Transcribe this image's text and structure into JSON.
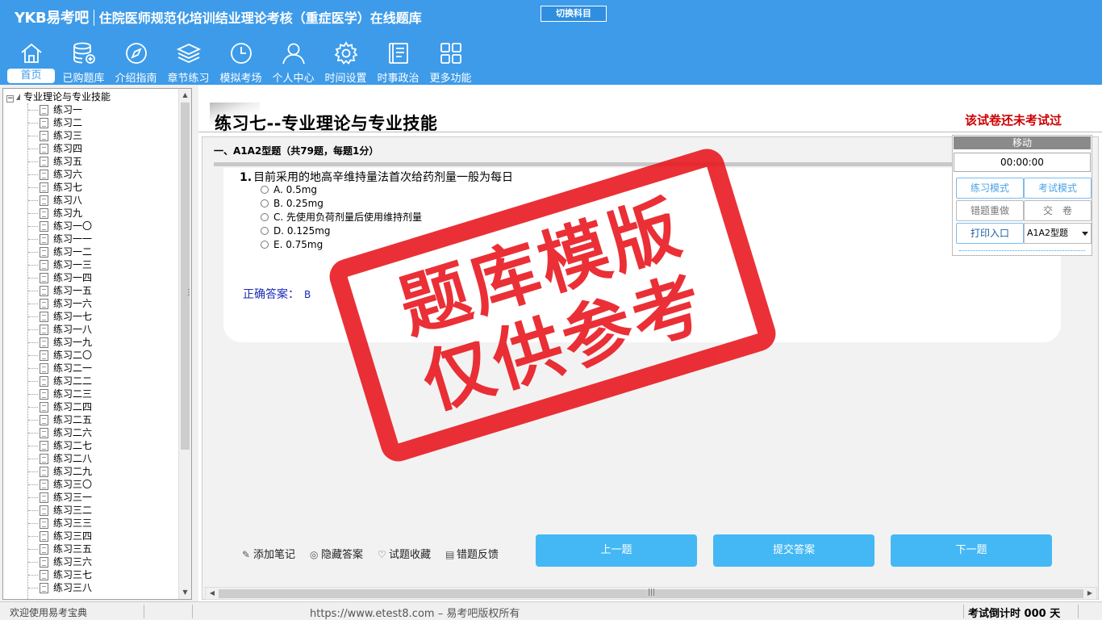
{
  "header": {
    "logo": "YKB易考吧",
    "title": "住院医师规范化培训结业理论考核（重症医学）在线题库",
    "switch_label": "切换科目"
  },
  "nav": [
    {
      "label": "首页",
      "icon": "home-icon"
    },
    {
      "label": "已购题库",
      "icon": "database-icon"
    },
    {
      "label": "介绍指南",
      "icon": "compass-icon"
    },
    {
      "label": "章节练习",
      "icon": "layers-icon"
    },
    {
      "label": "模拟考场",
      "icon": "clock-icon"
    },
    {
      "label": "个人中心",
      "icon": "user-icon"
    },
    {
      "label": "时间设置",
      "icon": "gear-icon"
    },
    {
      "label": "时事政治",
      "icon": "news-icon"
    },
    {
      "label": "更多功能",
      "icon": "grid-icon"
    }
  ],
  "tree": {
    "root": "专业理论与专业技能",
    "items": [
      "练习一",
      "练习二",
      "练习三",
      "练习四",
      "练习五",
      "练习六",
      "练习七",
      "练习八",
      "练习九",
      "练习一〇",
      "练习一一",
      "练习一二",
      "练习一三",
      "练习一四",
      "练习一五",
      "练习一六",
      "练习一七",
      "练习一八",
      "练习一九",
      "练习二〇",
      "练习二一",
      "练习二二",
      "练习二三",
      "练习二四",
      "练习二五",
      "练习二六",
      "练习二七",
      "练习二八",
      "练习二九",
      "练习三〇",
      "练习三一",
      "练习三二",
      "练习三三",
      "练习三四",
      "练习三五",
      "练习三六",
      "练习三七",
      "练习三八"
    ],
    "selected_index": 6
  },
  "main": {
    "paper_title": "练习七--专业理论与专业技能",
    "status": "该试卷还未考试过",
    "section_heading": "一、A1A2型题（共79题，每题1分）",
    "question": {
      "number": "1.",
      "text": "目前采用的地高辛维持量法首次给药剂量一般为每日",
      "options": [
        "A. 0.5mg",
        "B. 0.25mg",
        "C. 先使用负荷剂量后使用维持剂量",
        "D. 0.125mg",
        "E. 0.75mg"
      ],
      "answer_label": "正确答案：",
      "answer": "B"
    },
    "tools": [
      "添加笔记",
      "隐藏答案",
      "试题收藏",
      "错题反馈"
    ],
    "buttons": {
      "prev": "上一题",
      "submit": "提交答案",
      "next": "下一题"
    }
  },
  "panel": {
    "title": "移动",
    "timer": "00:00:00",
    "practice_mode": "练习模式",
    "exam_mode": "考试模式",
    "redo_wrong": "错题重做",
    "hand_in": "交　卷",
    "print": "打印入口",
    "question_type": "A1A2型题"
  },
  "watermark": {
    "line1": "题库模版",
    "line2": "仅供参考"
  },
  "statusbar": {
    "welcome": "欢迎使用易考宝典",
    "url": "https://www.etest8.com – 易考吧版权所有",
    "countdown": "考试倒计时 000 天"
  },
  "colors": {
    "header_blue": "#3d9be9",
    "button_blue": "#44b8f5",
    "stamp_red": "#e8141b",
    "status_red": "#cc0000",
    "answer_blue": "#1a2bb5"
  }
}
